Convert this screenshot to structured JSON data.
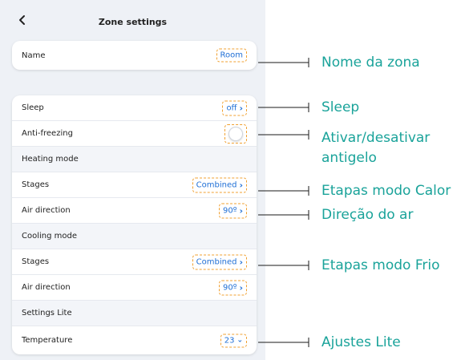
{
  "header": {
    "title": "Zone settings"
  },
  "name_card": {
    "label": "Name",
    "value": "Room"
  },
  "settings": {
    "sleep": {
      "label": "Sleep",
      "value": "off"
    },
    "anti_freezing": {
      "label": "Anti-freezing"
    },
    "heating_mode": {
      "label": "Heating mode"
    },
    "heating_stages": {
      "label": "Stages",
      "value": "Combined"
    },
    "heating_air_direction": {
      "label": "Air direction",
      "value": "90º"
    },
    "cooling_mode": {
      "label": "Cooling mode"
    },
    "cooling_stages": {
      "label": "Stages",
      "value": "Combined"
    },
    "cooling_air_direction": {
      "label": "Air direction",
      "value": "90º"
    },
    "settings_lite": {
      "label": "Settings Lite"
    },
    "temperature": {
      "label": "Temperature",
      "value": "23"
    }
  },
  "annotations": {
    "zone_name": "Nome da zona",
    "sleep": "Sleep",
    "antifreeze_line1": "Ativar/desativar",
    "antifreeze_line2": "antigelo",
    "heat_stages": "Etapas modo Calor",
    "air_direction": "Direção do ar",
    "cold_stages": "Etapas modo Frio",
    "lite": "Ajustes Lite"
  },
  "colors": {
    "accent": "#1f6fd6",
    "highlight": "#f0a030",
    "annotation": "#1aa39a"
  }
}
